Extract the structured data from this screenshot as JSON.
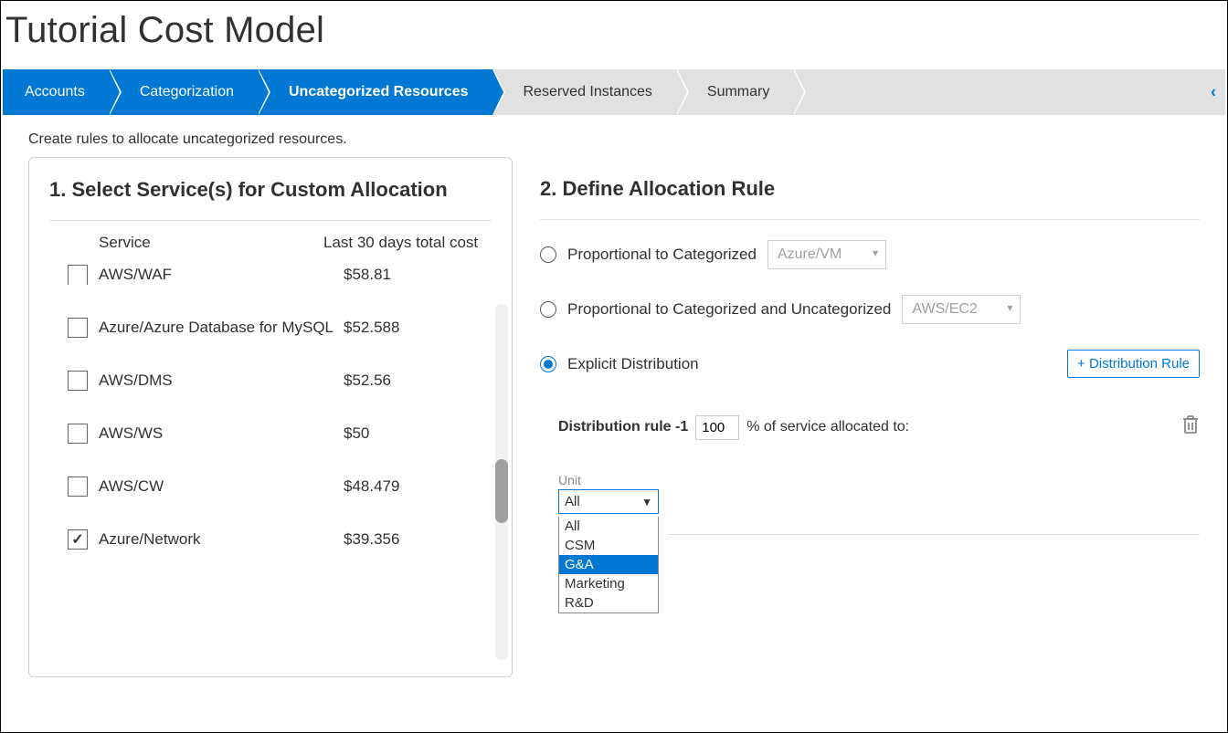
{
  "page_title": "Tutorial Cost Model",
  "wizard": {
    "steps": [
      "Accounts",
      "Categorization",
      "Uncategorized Resources",
      "Reserved Instances",
      "Summary"
    ],
    "collapse_icon": "‹"
  },
  "instructions": "Create rules to allocate uncategorized resources.",
  "panel1": {
    "heading": "1. Select Service(s) for Custom Allocation",
    "col_service": "Service",
    "col_cost": "Last 30 days total cost",
    "rows": [
      {
        "name": "AWS/WAF",
        "cost": "$58.81",
        "checked": false,
        "partial": true
      },
      {
        "name": "Azure/Azure Database for MySQL",
        "cost": "$52.588",
        "checked": false,
        "partial": false
      },
      {
        "name": "AWS/DMS",
        "cost": "$52.56",
        "checked": false,
        "partial": false
      },
      {
        "name": "AWS/WS",
        "cost": "$50",
        "checked": false,
        "partial": false
      },
      {
        "name": "AWS/CW",
        "cost": "$48.479",
        "checked": false,
        "partial": false
      },
      {
        "name": "Azure/Network",
        "cost": "$39.356",
        "checked": true,
        "partial": false
      }
    ]
  },
  "panel2": {
    "heading": "2. Define Allocation Rule",
    "opt1_label": "Proportional to Categorized",
    "opt1_select": "Azure/VM",
    "opt2_label": "Proportional to Categorized and Uncategorized",
    "opt2_select": "AWS/EC2",
    "opt3_label": "Explicit Distribution",
    "dist_button": "+ Distribution Rule",
    "rule_label": "Distribution rule -1",
    "rule_value": "100",
    "rule_suffix": "% of service allocated to:",
    "unit_label": "Unit",
    "unit_selected": "All",
    "unit_options": [
      "All",
      "CSM",
      "G&A",
      "Marketing",
      "R&D"
    ],
    "unit_highlight_index": 2
  }
}
